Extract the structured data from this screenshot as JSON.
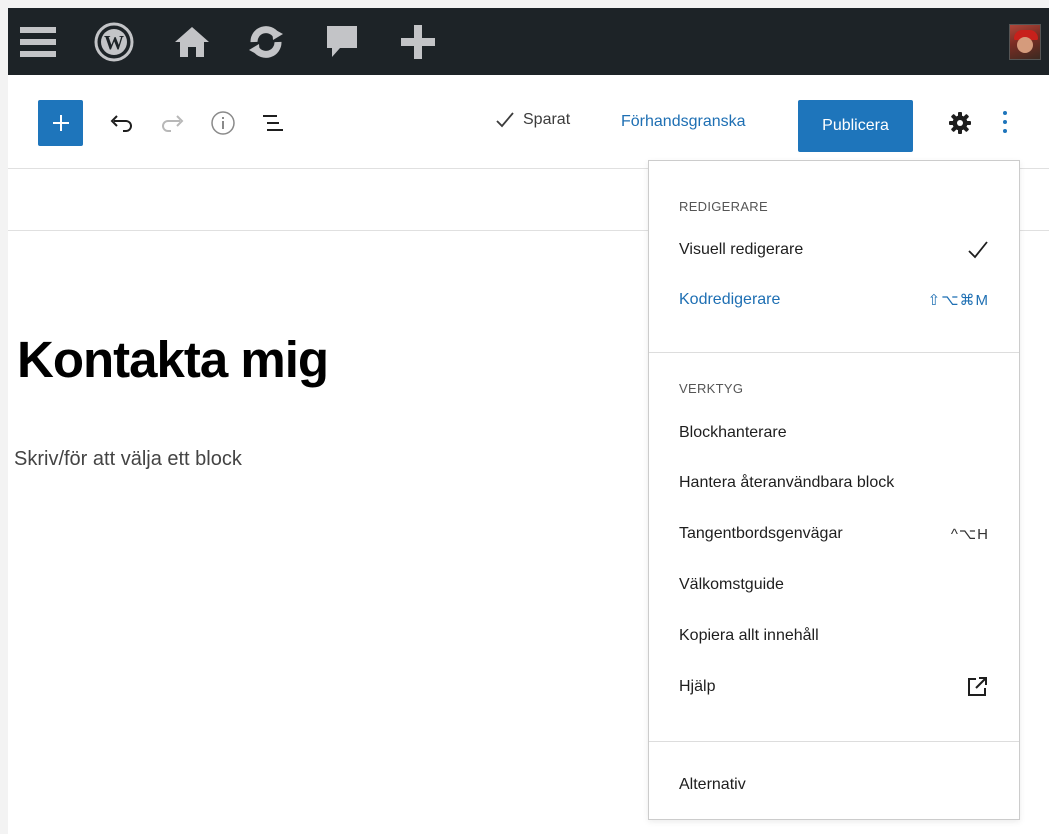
{
  "admin_bar": {
    "icons": [
      "menu-icon",
      "wordpress-logo-icon",
      "home-icon",
      "updates-icon",
      "comments-icon",
      "add-new-icon"
    ],
    "avatar": "user-avatar"
  },
  "toolbar": {
    "saved_label": "Sparat",
    "preview_label": "Förhandsgranska",
    "publish_label": "Publicera",
    "accent_color": "#1e75bb"
  },
  "content": {
    "post_title": "Kontakta mig",
    "block_placeholder": "Skriv/för att välja ett block"
  },
  "menu": {
    "editor_section": {
      "label": "REDIGERARE",
      "items": [
        {
          "label": "Visuell redigerare",
          "shortcut": "✓"
        },
        {
          "label": "Kodredigerare",
          "shortcut": "⇧⌥⌘M"
        }
      ]
    },
    "tools_section": {
      "label": "VERKTYG",
      "items": [
        {
          "label": "Blockhanterare",
          "shortcut": ""
        },
        {
          "label": "Hantera återanvändbara block",
          "shortcut": ""
        },
        {
          "label": "Tangentbordsgenvägar",
          "shortcut": "^⌥H"
        },
        {
          "label": "Välkomstguide",
          "shortcut": ""
        },
        {
          "label": "Kopiera allt innehåll",
          "shortcut": ""
        },
        {
          "label": "Hjälp",
          "shortcut": ""
        }
      ]
    },
    "options_label": "Alternativ"
  }
}
